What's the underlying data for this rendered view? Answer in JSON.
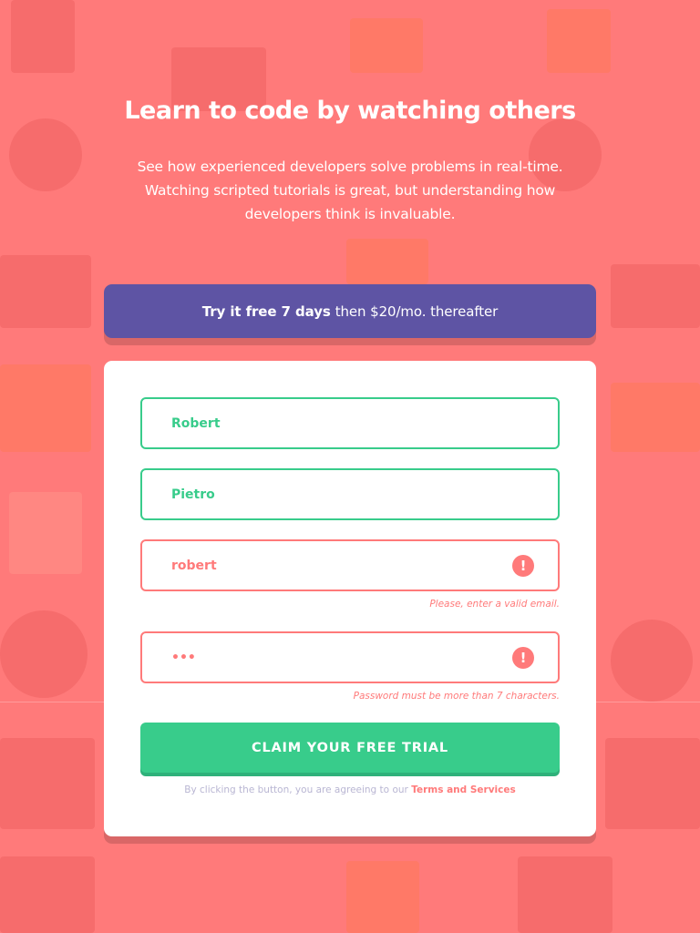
{
  "page": {
    "headline": "Learn to code by watching others",
    "intro": "See how experienced developers solve problems in real-time. Watching scripted tutorials is great, but understanding how developers think is invaluable."
  },
  "trial_banner": {
    "bold_text": "Try it free 7 days",
    "rest_text": "then $20/mo. thereafter"
  },
  "form": {
    "first_name": {
      "value": "Robert",
      "state": "valid"
    },
    "last_name": {
      "value": "Pietro",
      "state": "valid"
    },
    "email": {
      "value": "robert",
      "state": "error",
      "error_message": "Please, enter a valid email."
    },
    "password": {
      "value": "•••",
      "state": "error",
      "error_message": "Password must be more than 7 characters."
    },
    "submit_label": "Claim your free trial",
    "terms_prefix": "By clicking the button, you are agreeing to our",
    "terms_link": "Terms and Services",
    "error_icon": "!"
  },
  "colors": {
    "background": "#ff7a7a",
    "banner": "#5e54a4",
    "accent_green": "#38cc8b",
    "error_red": "#ff7a7a",
    "muted_text": "#b9b6d3"
  }
}
